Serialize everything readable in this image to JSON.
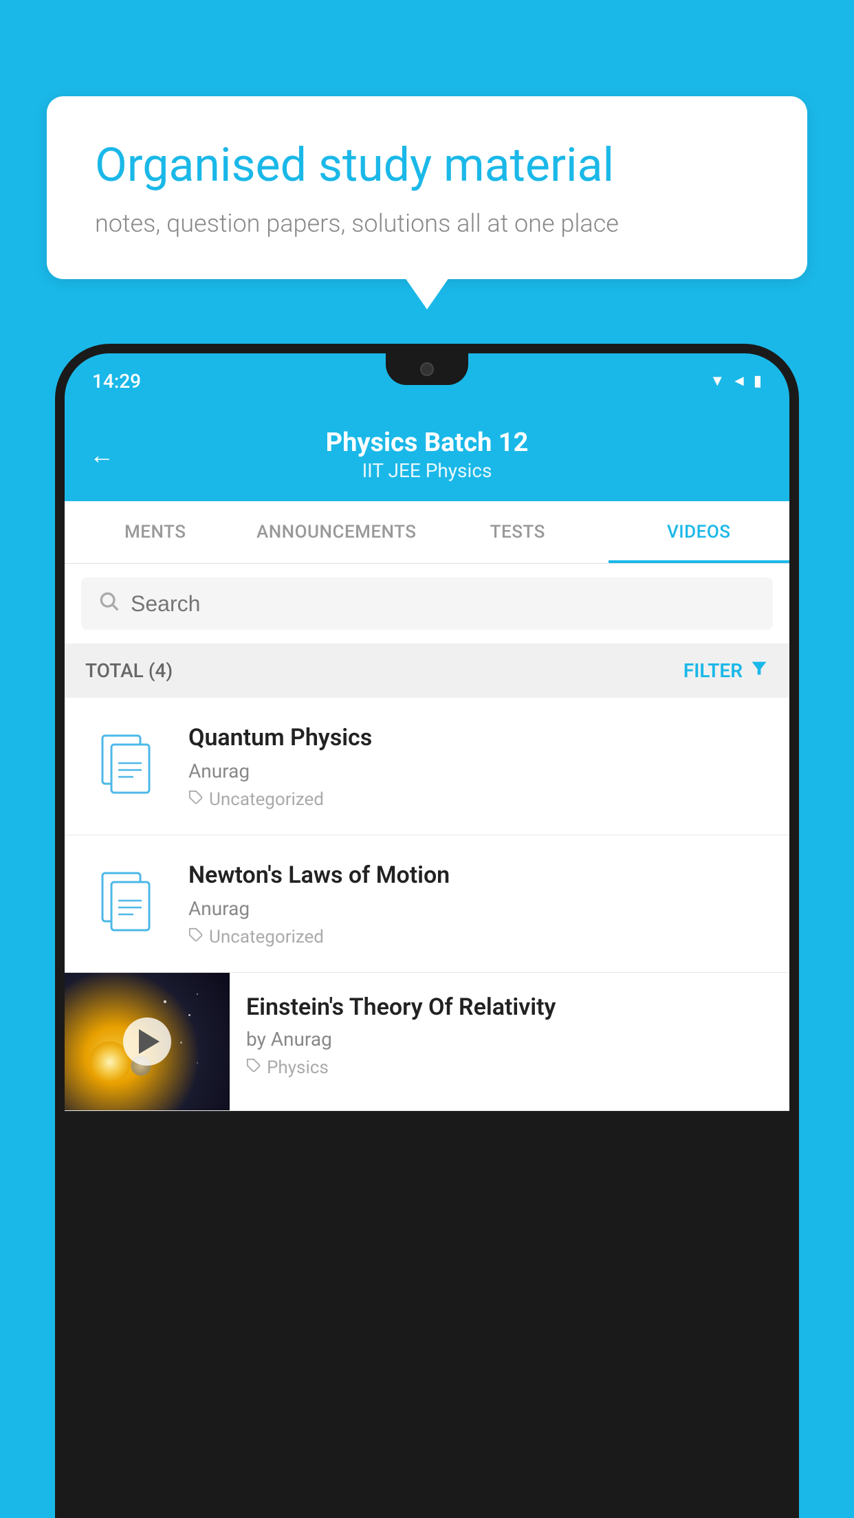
{
  "background_color": "#1ab8e8",
  "speech_bubble": {
    "title": "Organised study material",
    "subtitle": "notes, question papers, solutions all at one place"
  },
  "phone": {
    "time": "14:29",
    "header": {
      "title": "Physics Batch 12",
      "subtitle": "IIT JEE   Physics",
      "back_label": "←"
    },
    "tabs": [
      {
        "label": "MENTS",
        "active": false
      },
      {
        "label": "ANNOUNCEMENTS",
        "active": false
      },
      {
        "label": "TESTS",
        "active": false
      },
      {
        "label": "VIDEOS",
        "active": true
      }
    ],
    "search": {
      "placeholder": "Search"
    },
    "filter_bar": {
      "total": "TOTAL (4)",
      "filter_label": "FILTER"
    },
    "videos": [
      {
        "id": 1,
        "title": "Quantum Physics",
        "author": "Anurag",
        "tag": "Uncategorized",
        "has_thumbnail": false
      },
      {
        "id": 2,
        "title": "Newton's Laws of Motion",
        "author": "Anurag",
        "tag": "Uncategorized",
        "has_thumbnail": false
      },
      {
        "id": 3,
        "title": "Einstein's Theory Of Relativity",
        "author": "by Anurag",
        "tag": "Physics",
        "has_thumbnail": true
      }
    ]
  }
}
